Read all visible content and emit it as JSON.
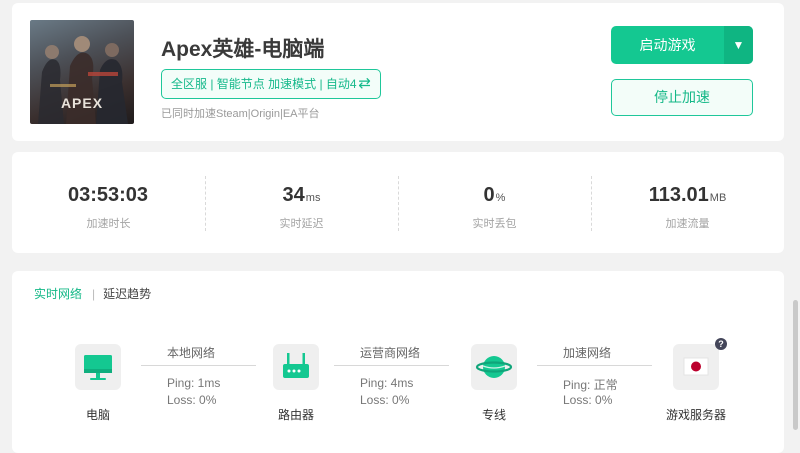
{
  "game": {
    "title": "Apex英雄-电脑端",
    "thumbnail_text": "APEX",
    "mode_tag": "全区服 | 智能节点 加速模式 | 自动4",
    "swap_icon": "swap-arrows-icon",
    "platform_note": "已同时加速Steam|Origin|EA平台"
  },
  "actions": {
    "launch_label": "启动游戏",
    "launch_dropdown": "▼",
    "stop_label": "停止加速"
  },
  "stats": [
    {
      "value": "03:53:03",
      "unit": "",
      "label": "加速时长"
    },
    {
      "value": "34",
      "unit": "ms",
      "label": "实时延迟"
    },
    {
      "value": "0",
      "unit": "%",
      "label": "实时丢包"
    },
    {
      "value": "113.01",
      "unit": "MB",
      "label": "加速流量"
    }
  ],
  "network": {
    "tabs": {
      "active": "实时网络",
      "separator": "|",
      "inactive": "延迟趋势"
    },
    "nodes": [
      {
        "label": "电脑",
        "icon": "monitor-icon"
      },
      {
        "label": "路由器",
        "icon": "router-icon"
      },
      {
        "label": "专线",
        "icon": "planet-icon"
      },
      {
        "label": "游戏服务器",
        "icon": "japan-flag-icon"
      }
    ],
    "links": [
      {
        "title": "本地网络",
        "ping": "Ping: 1ms",
        "loss": "Loss: 0%"
      },
      {
        "title": "运营商网络",
        "ping": "Ping: 4ms",
        "loss": "Loss: 0%"
      },
      {
        "title": "加速网络",
        "ping": "Ping: 正常",
        "loss": "Loss: 0%"
      }
    ],
    "help_icon": "?"
  },
  "colors": {
    "accent": "#14c891",
    "accent_dark": "#0fb582",
    "tag_text": "#16b98b",
    "flag_red": "#bc002d"
  }
}
